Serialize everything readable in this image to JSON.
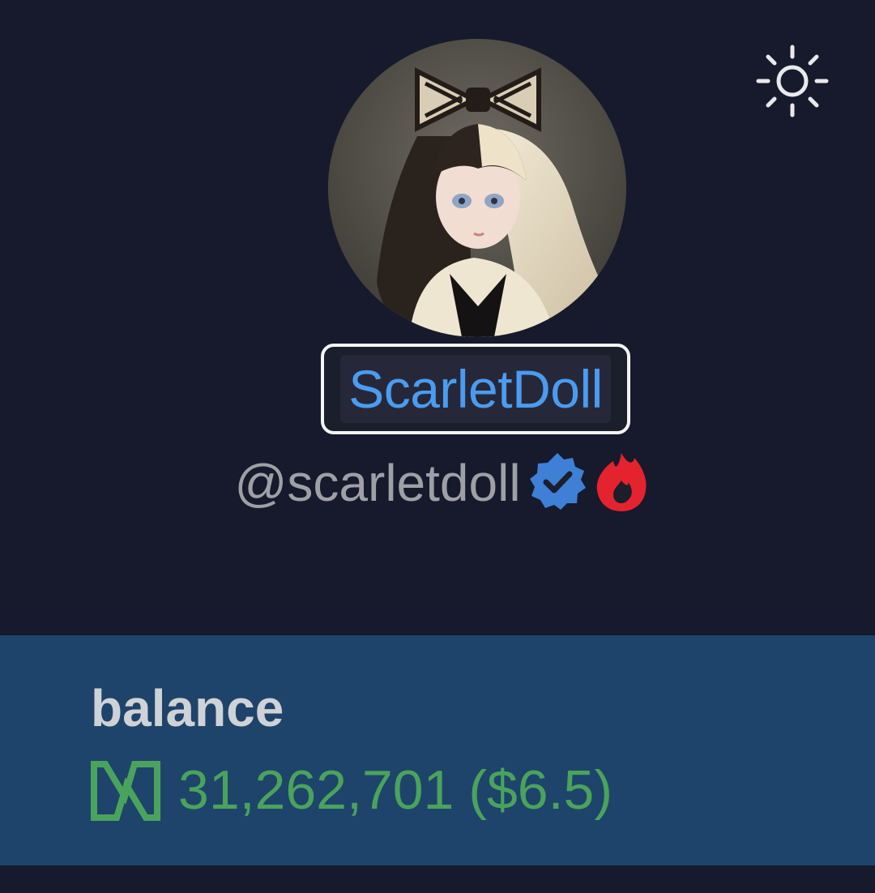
{
  "profile": {
    "display_name": "ScarletDoll",
    "handle": "@scarletdoll",
    "badges": [
      "verified-badge-icon",
      "flame-badge-icon"
    ]
  },
  "header": {
    "settings_icon": "sun-icon"
  },
  "balance": {
    "label": "balance",
    "token_icon": "near-token-icon",
    "amount": "31,262,701",
    "usd": "($6.5)"
  },
  "colors": {
    "background": "#161a2c",
    "panel": "#1e446b",
    "name": "#4a9cf0",
    "handle": "#9ea0a6",
    "balance_text": "#4aa35c",
    "verified": "#3f7fd6",
    "flame": "#e5232e"
  }
}
